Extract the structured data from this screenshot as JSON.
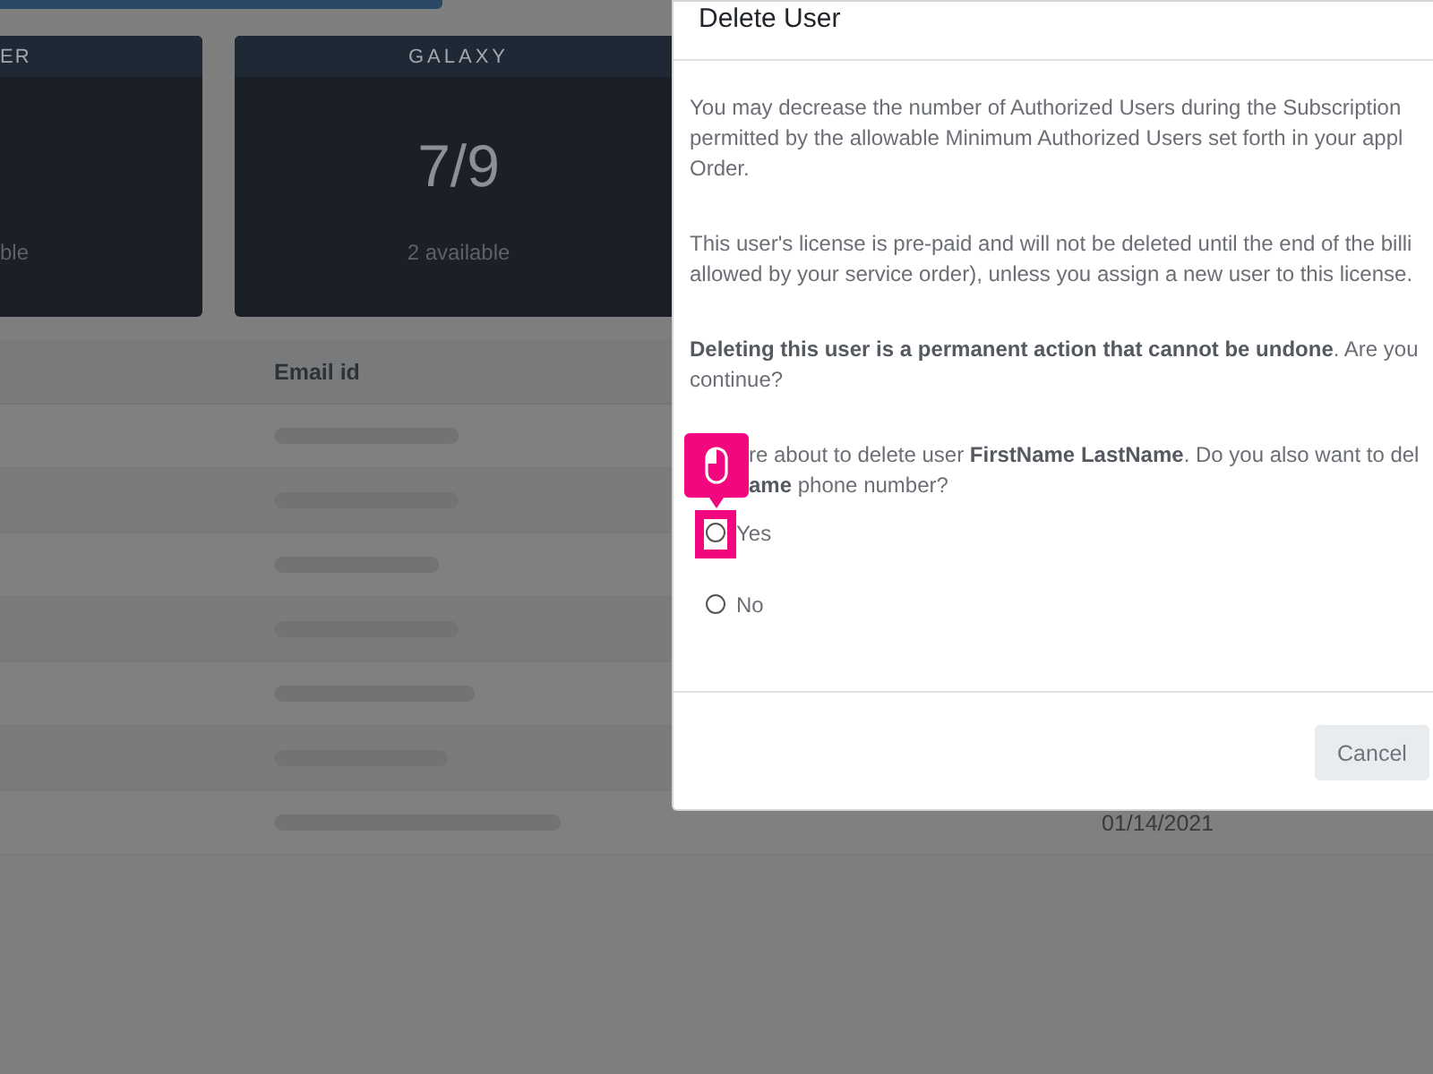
{
  "cards": [
    {
      "title": "ER",
      "caption": "ble"
    },
    {
      "title": "GALAXY",
      "value": "7/9",
      "caption": "2 available"
    }
  ],
  "table": {
    "columns": [
      "Email id"
    ],
    "rows": [
      {
        "email_blurred": true
      },
      {
        "email_blurred": true
      },
      {
        "email_blurred": true
      },
      {
        "email_blurred": true
      },
      {
        "email_blurred": true
      },
      {
        "email_blurred": true
      },
      {
        "email_blurred": true,
        "column_3": "01/14/2021"
      }
    ]
  },
  "dialog": {
    "title": "Delete User",
    "paragraphs": [
      {
        "lines": [
          "You may decrease the number of Authorized Users during the Subscription",
          "permitted by the allowable Minimum Authorized Users set forth in your appl",
          "Order."
        ]
      },
      {
        "lines": [
          "This user's license is pre-paid and will not be deleted until the end of the billi",
          "allowed by your service order), unless you assign a new user to this license."
        ]
      },
      {
        "lines": [
          "**Deleting this user is a permanent action that cannot be undone**. Are you",
          "continue?"
        ]
      }
    ],
    "question": {
      "lines": [
        "re about to delete user **FirstName LastName**. Do you also want to del",
        "**ame** phone number?"
      ]
    },
    "options": [
      {
        "label": "Yes",
        "selected": false,
        "highlighted": true
      },
      {
        "label": "No",
        "selected": false,
        "highlighted": false
      }
    ],
    "buttons": [
      {
        "label": "Cancel"
      }
    ]
  }
}
